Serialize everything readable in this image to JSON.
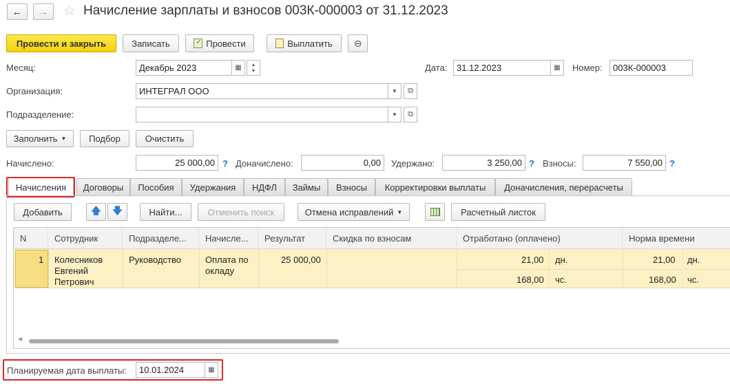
{
  "header": {
    "title": "Начисление зарплаты и взносов 003К-000003 от 31.12.2023"
  },
  "toolbar": {
    "post_close": "Провести и закрыть",
    "save": "Записать",
    "post": "Провести",
    "pay": "Выплатить"
  },
  "form": {
    "month_label": "Месяц:",
    "month_value": "Декабрь 2023",
    "date_label": "Дата:",
    "date_value": "31.12.2023",
    "number_label": "Номер:",
    "number_value": "003К-000003",
    "org_label": "Организация:",
    "org_value": "ИНТЕГРАЛ ООО",
    "dept_label": "Подразделение:",
    "dept_value": ""
  },
  "actions": {
    "fill": "Заполнить",
    "select": "Подбор",
    "clear": "Очистить"
  },
  "totals": {
    "accrued_label": "Начислено:",
    "accrued_value": "25 000,00",
    "additional_label": "Доначислено:",
    "additional_value": "0,00",
    "withheld_label": "Удержано:",
    "withheld_value": "3 250,00",
    "contrib_label": "Взносы:",
    "contrib_value": "7 550,00",
    "help": "?"
  },
  "tabs": [
    "Начисления",
    "Договоры",
    "Пособия",
    "Удержания",
    "НДФЛ",
    "Займы",
    "Взносы",
    "Корректировки выплаты",
    "Доначисления, перерасчеты"
  ],
  "table_toolbar": {
    "add": "Добавить",
    "find": "Найти...",
    "cancel_search": "Отменить поиск",
    "cancel_corrections": "Отмена исправлений",
    "payslip": "Расчетный листок"
  },
  "table": {
    "columns": [
      "N",
      "Сотрудник",
      "Подразделе...",
      "Начисле...",
      "Результат",
      "Скидка по взносам",
      "Отработано (оплачено)",
      "Норма времени"
    ],
    "row": {
      "n": "1",
      "employee_line1": "Колесников",
      "employee_line2": "Евгений",
      "employee_line3": "Петрович",
      "dept": "Руководство",
      "accrual_line1": "Оплата по",
      "accrual_line2": "окладу",
      "result": "25 000,00",
      "worked_days": "21,00",
      "days_unit": "дн.",
      "worked_hours": "168,00",
      "hours_unit": "чс.",
      "norm_days": "21,00",
      "norm_days_unit": "дн.",
      "norm_hours": "168,00",
      "norm_hours_unit": "чс."
    }
  },
  "footer": {
    "planned_date_label": "Планируемая дата выплаты:",
    "planned_date_value": "10.01.2024"
  },
  "colors": {
    "primary_button": "#f3d10c",
    "selected_row": "#fbf1c4",
    "highlight_border": "#d9262a",
    "help_mark": "#1c6ec2"
  }
}
